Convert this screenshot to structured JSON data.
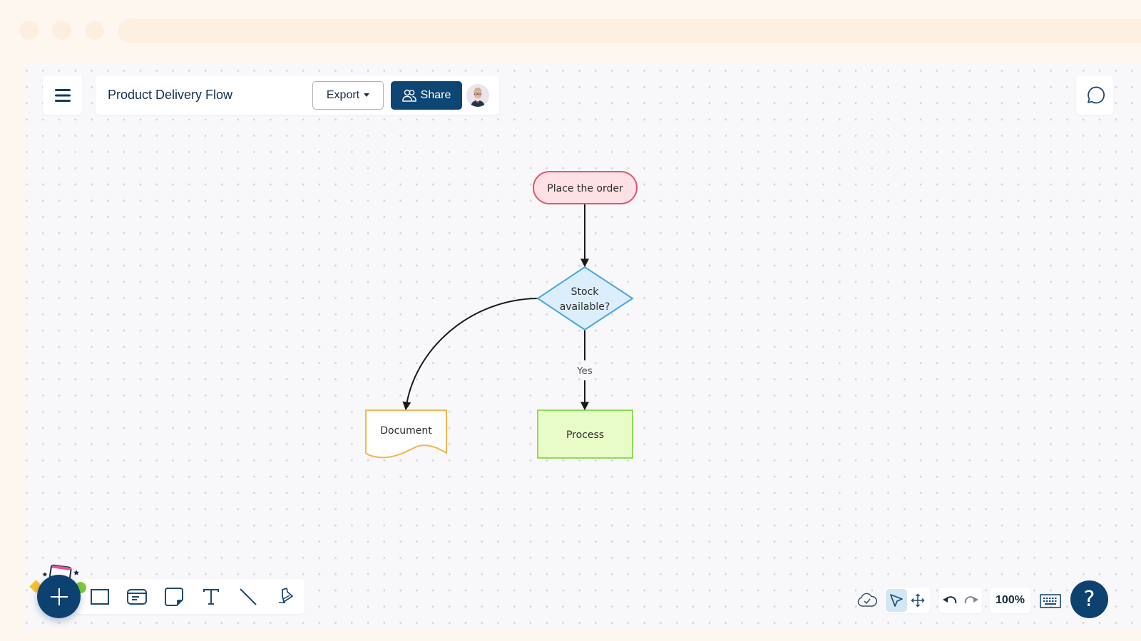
{
  "header": {
    "doc_title": "Product Delivery Flow",
    "export_label": "Export",
    "share_label": "Share",
    "avatar_alt": "User avatar"
  },
  "icons": {
    "menu": "hamburger-menu-icon",
    "comment": "comment-bubble-icon",
    "share": "users-icon",
    "export_caret": "caret-down-icon"
  },
  "diagram": {
    "nodes": [
      {
        "id": "start",
        "shape": "terminator",
        "label": "Place the order",
        "fill": "#fde1e5",
        "stroke": "#e05570"
      },
      {
        "id": "decision",
        "shape": "decision",
        "label_lines": [
          "Stock",
          "available?"
        ],
        "fill": "#dceefb",
        "stroke": "#47a6dd"
      },
      {
        "id": "document",
        "shape": "document",
        "label": "Document",
        "fill": "#ffffff",
        "stroke": "#f5b351"
      },
      {
        "id": "process",
        "shape": "process",
        "label": "Process",
        "fill": "#e8fcc8",
        "stroke": "#8ed956"
      }
    ],
    "edges": [
      {
        "from": "start",
        "to": "decision",
        "label": ""
      },
      {
        "from": "decision",
        "to": "document",
        "label": ""
      },
      {
        "from": "decision",
        "to": "process",
        "label": "Yes"
      }
    ]
  },
  "toolbar": {
    "tools": [
      {
        "name": "rectangle-tool",
        "icon": "rectangle-icon"
      },
      {
        "name": "card-tool",
        "icon": "card-icon"
      },
      {
        "name": "sticky-note-tool",
        "icon": "sticky-note-icon"
      },
      {
        "name": "text-tool",
        "icon": "text-icon"
      },
      {
        "name": "line-tool",
        "icon": "line-icon"
      },
      {
        "name": "pen-tool",
        "icon": "pen-icon"
      }
    ],
    "add_label": "+"
  },
  "status": {
    "save_state": "saved-to-cloud",
    "zoom_level": "100%",
    "active_mode": "select",
    "help_label": "?"
  },
  "colors": {
    "primary": "#0d4270",
    "canvas_bg": "#f8f8fa",
    "frame_bg": "#fef7f0"
  }
}
